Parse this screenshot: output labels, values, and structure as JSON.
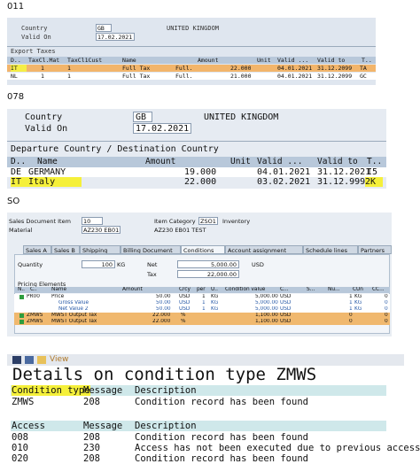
{
  "captions": {
    "c1": "011",
    "c2": "078",
    "c3": "SO"
  },
  "panel1": {
    "country_label": "Country",
    "country_value": "GB",
    "country_name": "UNITED KINGDOM",
    "valid_label": "Valid On",
    "valid_value": "17.02.2021",
    "section_title": "Export Taxes",
    "columns": [
      "D..",
      "TaxCl.Mat",
      "TaxCl1Cust",
      "Name",
      "Amount",
      "Unit",
      "Valid ...",
      "Valid to",
      "T.."
    ],
    "rows": [
      {
        "d": "IT",
        "taxmat": "1",
        "taxcust": "1",
        "name": "Full Tax",
        "name2": "Full.",
        "amount": "22.000",
        "unit": "",
        "from": "04.01.2021",
        "to": "31.12.2099",
        "t": "TA"
      },
      {
        "d": "NL",
        "taxmat": "1",
        "taxcust": "1",
        "name": "Full Tax",
        "name2": "Full.",
        "amount": "21.000",
        "unit": "",
        "from": "04.01.2021",
        "to": "31.12.2099",
        "t": "GC"
      }
    ]
  },
  "panel2": {
    "country_label": "Country",
    "country_value": "GB",
    "country_name": "UNITED KINGDOM",
    "valid_label": "Valid On",
    "valid_value": "17.02.2021",
    "section_title": "Departure Country / Destination Country",
    "columns": [
      "D..",
      "Name",
      "Amount",
      "Unit",
      "Valid ...",
      "Valid to",
      "T.."
    ],
    "rows": [
      {
        "d": "DE",
        "name": "GERMANY",
        "amount": "19.000",
        "unit": "",
        "from": "04.01.2021",
        "to": "31.12.2021",
        "t": "I5"
      },
      {
        "d": "IT",
        "name": "Italy",
        "amount": "22.000",
        "unit": "",
        "from": "03.02.2021",
        "to": "31.12.9999",
        "t": "2K"
      }
    ]
  },
  "panel3": {
    "sd_label": "Sales Document Item",
    "sd_value": "10",
    "cat_label": "Item Category",
    "cat_value": "ZSO1",
    "cat_text": "Inventory",
    "mat_label": "Material",
    "mat_value": "AZ230 EB01",
    "mat_text": "AZ230 EB01 TEST",
    "tabs": [
      "Sales A",
      "Sales B",
      "Shipping",
      "Billing Document",
      "Conditions",
      "Account assignment",
      "Schedule lines",
      "Partners"
    ],
    "qty_label": "Quantity",
    "qty_value": "100",
    "qty_unit": "KG",
    "net_label": "Net",
    "net_value": "5,000.00",
    "net_cur": "USD",
    "tax_label": "Tax",
    "tax_value": "22,000.00",
    "pricing_title": "Pricing Elements",
    "columns": [
      "N..",
      "C..",
      "Name",
      "Amount",
      "Crcy",
      "per",
      "U..",
      "Condition value",
      "C...",
      "S...",
      "Nu...",
      "CUn",
      "CC..."
    ],
    "rows": [
      {
        "ctype": "PR00",
        "name": "Price",
        "amount": "50.00",
        "crcy": "USD",
        "per": "1",
        "u": "KG",
        "value": "5,000.00",
        "cur": "USD",
        "cun": "1",
        "unit2": "KG",
        "cc": "0",
        "style": "normal"
      },
      {
        "ctype": "",
        "name": "Gross Value",
        "amount": "50.00",
        "crcy": "USD",
        "per": "1",
        "u": "KG",
        "value": "5,000.00",
        "cur": "USD",
        "cun": "1",
        "unit2": "KG",
        "cc": "0",
        "style": "blue"
      },
      {
        "ctype": "",
        "name": "Net Value 2",
        "amount": "50.00",
        "crcy": "USD",
        "per": "1",
        "u": "KG",
        "value": "5,000.00",
        "cur": "USD",
        "cun": "1",
        "unit2": "KG",
        "cc": "0",
        "style": "blue"
      },
      {
        "ctype": "ZMWS",
        "name": "MWST Output Tax",
        "amount": "22.000",
        "crcy": "%",
        "per": "",
        "u": "",
        "value": "1,100.00",
        "cur": "USD",
        "cun": "0",
        "unit2": "",
        "cc": "0",
        "style": "hl"
      },
      {
        "ctype": "ZMWS",
        "name": "MWST Output Tax",
        "amount": "22.000",
        "crcy": "%",
        "per": "",
        "u": "",
        "value": "1,100.00",
        "cur": "USD",
        "cun": "0",
        "unit2": "",
        "cc": "0",
        "style": "hl"
      }
    ]
  },
  "panel4": {
    "toolbar_text": "View",
    "title": "Details on condition type ZMWS",
    "hdr1": {
      "c1": "Condition type",
      "c2": "Message",
      "c3": "Description"
    },
    "row1": {
      "c1": "ZMWS",
      "c2": "208",
      "c3": "Condition record has been found"
    },
    "hdr2": {
      "c1": "Access",
      "c2": "Message",
      "c3": "Description"
    },
    "access_rows": [
      {
        "c1": "008",
        "c2": "208",
        "c3": "Condition record has been found"
      },
      {
        "c1": "010",
        "c2": "230",
        "c3": "Access has not been executed due to previous access"
      },
      {
        "c1": "020",
        "c2": "208",
        "c3": "Condition record has been found"
      }
    ]
  }
}
